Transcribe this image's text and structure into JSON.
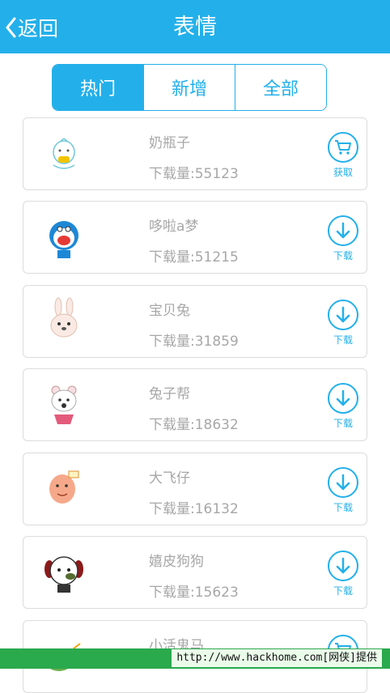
{
  "header": {
    "back_label": "返回",
    "title": "表情"
  },
  "tabs": [
    {
      "label": "热门",
      "active": true
    },
    {
      "label": "新增",
      "active": false
    },
    {
      "label": "全部",
      "active": false
    }
  ],
  "items": [
    {
      "name": "奶瓶子",
      "downloads": "下载量:55123",
      "action": "获取",
      "action_icon": "cart-icon"
    },
    {
      "name": "哆啦a梦",
      "downloads": "下载量:51215",
      "action": "下载",
      "action_icon": "download-icon"
    },
    {
      "name": "宝贝兔",
      "downloads": "下载量:31859",
      "action": "下载",
      "action_icon": "download-icon"
    },
    {
      "name": "兔子帮",
      "downloads": "下载量:18632",
      "action": "下载",
      "action_icon": "download-icon"
    },
    {
      "name": "大飞仔",
      "downloads": "下载量:16132",
      "action": "下载",
      "action_icon": "download-icon"
    },
    {
      "name": "嬉皮狗狗",
      "downloads": "下载量:15623",
      "action": "下载",
      "action_icon": "download-icon"
    },
    {
      "name": "小活鬼马",
      "downloads": "",
      "action": "",
      "action_icon": "cart-icon"
    }
  ],
  "watermark": "http://www.hackhome.com[网侠]提供",
  "colors": {
    "accent": "#23b0ea",
    "footer": "#2aa94d"
  }
}
